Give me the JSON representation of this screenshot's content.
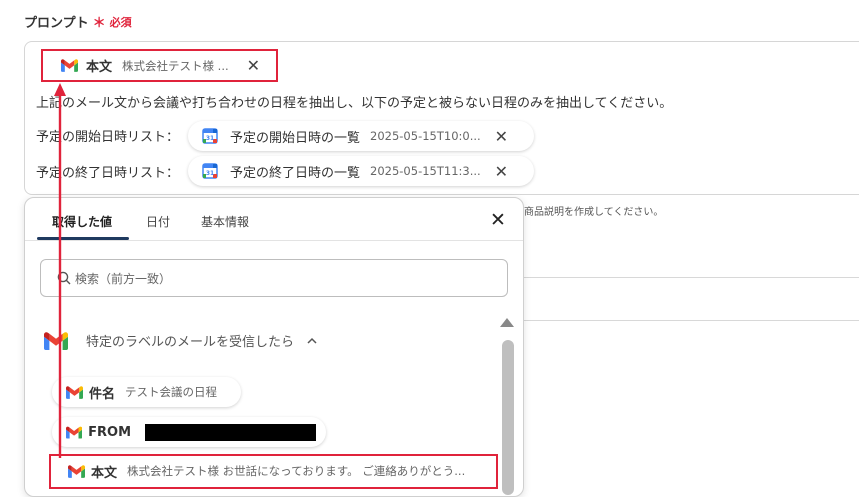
{
  "field": {
    "label": "プロンプト",
    "required_mark": "＊",
    "required_text": "必須"
  },
  "prompt": {
    "chip_main": {
      "name": "本文",
      "value": "株式会社テスト様 ..."
    },
    "instruction": "上記のメール文から会議や打ち合わせの日程を抽出し、以下の予定と被らない日程のみを抽出してください。",
    "start_label": "予定の開始日時リスト：",
    "start_chip": {
      "name": "予定の開始日時の一覧",
      "value": "2025-05-15T10:0..."
    },
    "end_label": "予定の終了日時リスト：",
    "end_chip": {
      "name": "予定の終了日時の一覧",
      "value": "2025-05-15T11:3..."
    }
  },
  "background_hint": "商品説明を作成してください。",
  "panel": {
    "tabs": [
      "取得した値",
      "日付",
      "基本情報"
    ],
    "active_tab": 0,
    "close_glyph": "✕",
    "search_placeholder": "検索（前方一致）",
    "section_title": "特定のラベルのメールを受信したら",
    "items": [
      {
        "name": "件名",
        "value": "テスト会議の日程"
      },
      {
        "name": "FROM",
        "value": ""
      },
      {
        "name": "本文",
        "value": "株式会社テスト様 お世話になっております。 ご連絡ありがとう..."
      }
    ]
  },
  "colors": {
    "required": "#e0233b",
    "highlight": "#e0233b",
    "tab_active": "#1f3a5f"
  },
  "icons": {
    "gmail": "gmail-icon",
    "calendar": "google-calendar-icon",
    "close": "close-icon",
    "search": "search-icon",
    "chevron": "chevron-up-icon"
  }
}
